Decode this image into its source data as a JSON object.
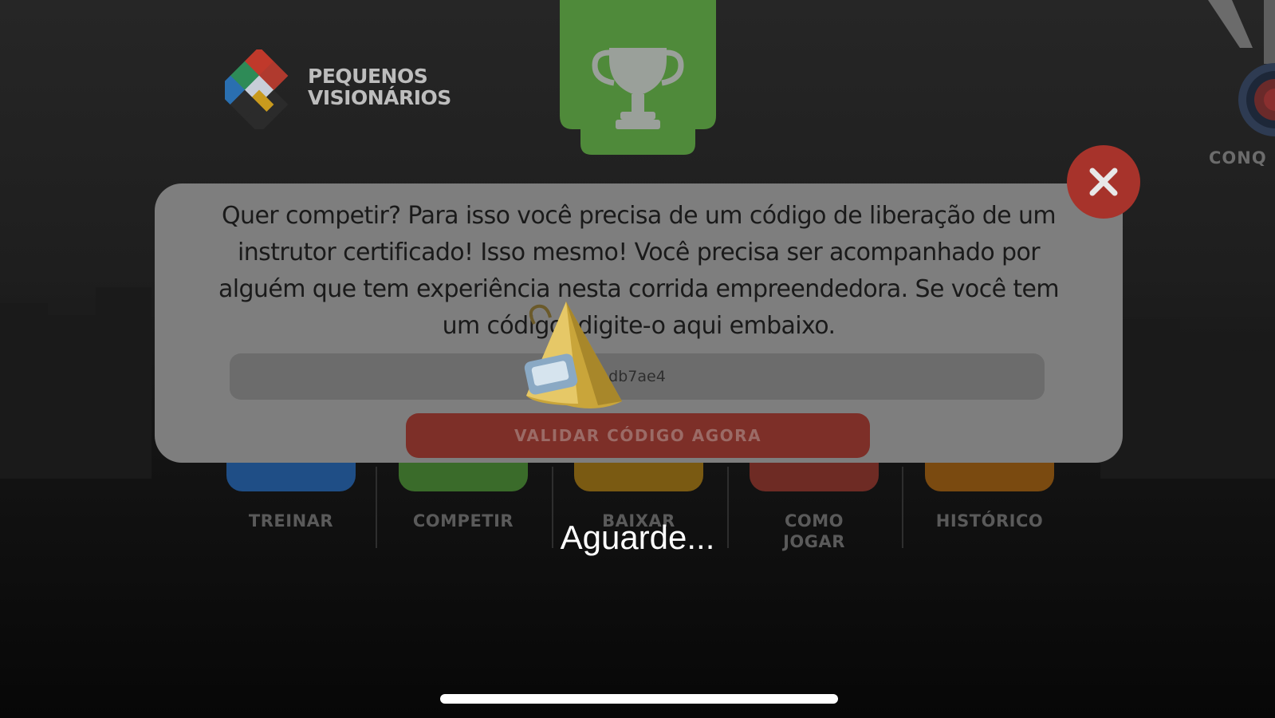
{
  "brand": {
    "line1": "PEQUENOS",
    "line2": "VISIONÁRIOS"
  },
  "achievements": {
    "label": "CONQ"
  },
  "menu": {
    "items": [
      {
        "label": "TREINAR",
        "color": "#1f4e86"
      },
      {
        "label": "COMPETIR",
        "color": "#3a6b2a"
      },
      {
        "label": "BAIXAR",
        "color": "#7a5a12"
      },
      {
        "label": "COMO JOGAR",
        "color": "#6e2b24"
      },
      {
        "label": "HISTÓRICO",
        "color": "#7a4a10"
      }
    ]
  },
  "dialog": {
    "message": "Quer competir? Para isso você precisa de um código de liberação de um instrutor certificado! Isso mesmo! Você precisa ser acompanhado por alguém que tem experiência nesta corrida empreendedora. Se você tem um código, digite-o aqui embaixo.",
    "code_value": "db7ae4",
    "validate_label": "VALIDAR CÓDIGO AGORA",
    "close_label": "✕"
  },
  "loading": {
    "text": "Aguarde..."
  },
  "colors": {
    "trophy_tab": "#4f8a3a",
    "close": "#a7332b",
    "validate": "#7d2f28"
  }
}
